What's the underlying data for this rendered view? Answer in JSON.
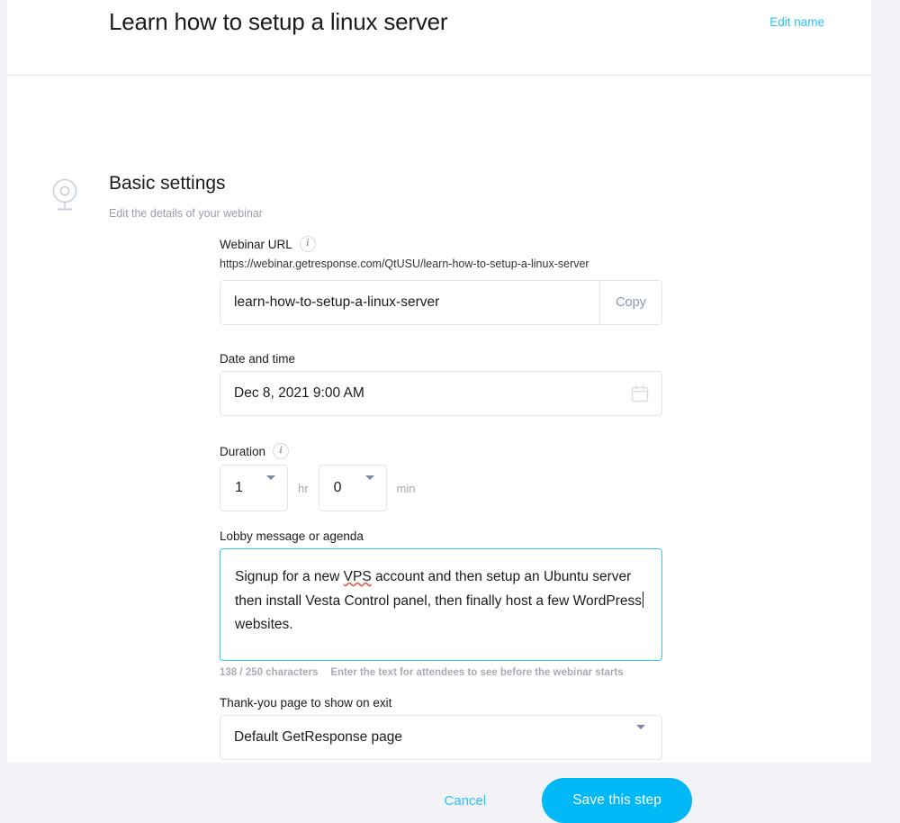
{
  "header": {
    "title": "Learn how to setup a linux server",
    "edit_name_label": "Edit name"
  },
  "section": {
    "icon": "webcam-icon",
    "title": "Basic settings",
    "subtitle": "Edit the details of your webinar"
  },
  "fields": {
    "webinar_url": {
      "label": "Webinar URL",
      "info_icon": "info-icon",
      "preview": "https://webinar.getresponse.com/QtUSU/learn-how-to-setup-a-linux-server",
      "value": "learn-how-to-setup-a-linux-server",
      "copy_label": "Copy"
    },
    "date_time": {
      "label": "Date and time",
      "value": "Dec 8, 2021 9:00 AM",
      "icon": "calendar-icon"
    },
    "duration": {
      "label": "Duration",
      "info_icon": "info-icon",
      "hours_value": "1",
      "hours_unit": "hr",
      "minutes_value": "0",
      "minutes_unit": "min"
    },
    "lobby_message": {
      "label": "Lobby message or agenda",
      "text_before": "Signup for a new ",
      "misspelled": "VPS",
      "text_middle": " account and then setup an Ubuntu server then install Vesta Control panel, then finally host a few WordPress",
      "text_after": " websites.",
      "counter": "138 / 250 characters",
      "hint": "Enter the text for attendees to see before the webinar starts"
    },
    "thank_you_page": {
      "label": "Thank-you page to show on exit",
      "value": "Default GetResponse page",
      "icon": "chevron-down-icon"
    }
  },
  "footer": {
    "cancel_label": "Cancel",
    "save_label": "Save this step"
  },
  "colors": {
    "accent": "#00b8f5",
    "link": "#27c3f7",
    "focus_border": "#34c8f8",
    "page_bg": "#f2f3f7",
    "border": "#e4e6eb"
  }
}
